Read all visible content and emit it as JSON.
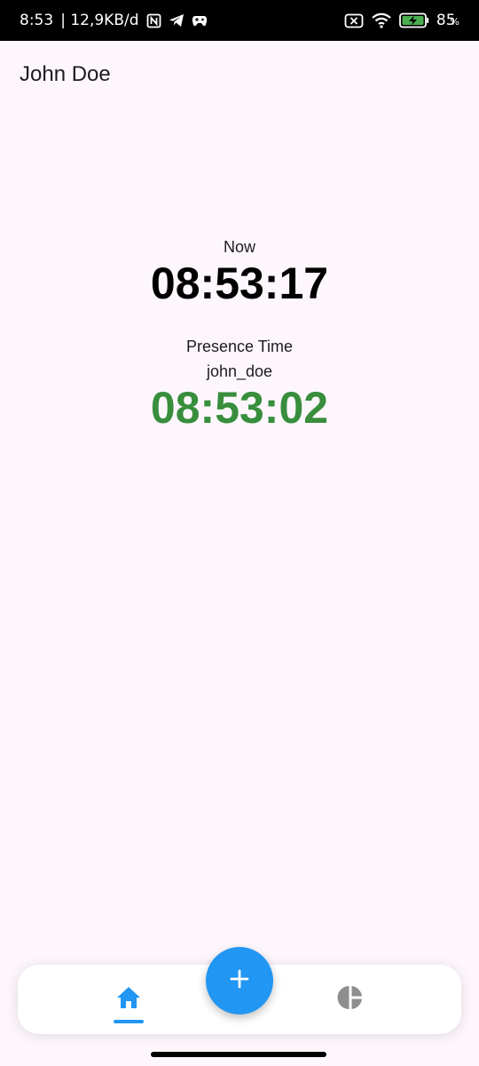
{
  "status_bar": {
    "time": "8:53",
    "network_speed": "| 12,9KB/d",
    "battery_level": "85",
    "battery_unit": "%",
    "icons": [
      "nfc-icon",
      "telegram-icon",
      "game-icon",
      "sim-off-icon",
      "wifi-icon",
      "battery-charging-icon"
    ]
  },
  "app_bar": {
    "title": "John Doe"
  },
  "main": {
    "now_label": "Now",
    "now_time": "08:53:17",
    "presence_label": "Presence Time",
    "username": "john_doe",
    "presence_time": "08:53:02"
  },
  "bottom_nav": {
    "items": [
      {
        "icon": "home-icon",
        "selected": true
      },
      {
        "icon": "pie-chart-icon",
        "selected": false
      }
    ],
    "fab_icon": "plus-icon"
  },
  "colors": {
    "accent": "#2196f3",
    "presence_green": "#388e3c",
    "background": "#fdf7fd",
    "inactive_icon": "#8e8e8e"
  }
}
